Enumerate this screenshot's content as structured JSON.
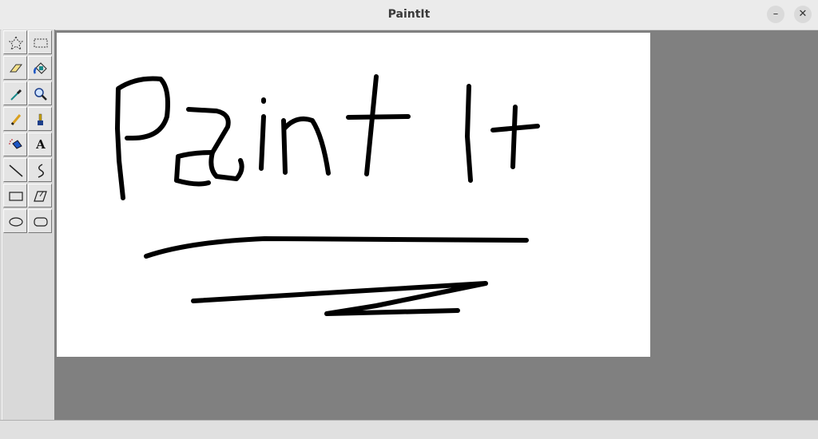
{
  "window": {
    "title": "PaintIt",
    "minimize_label": "–",
    "close_label": "✕"
  },
  "toolbox": {
    "tools": [
      {
        "name": "free-form-select-icon"
      },
      {
        "name": "rect-select-icon"
      },
      {
        "name": "eraser-icon"
      },
      {
        "name": "fill-bucket-icon"
      },
      {
        "name": "color-picker-icon"
      },
      {
        "name": "magnifier-icon"
      },
      {
        "name": "pencil-icon"
      },
      {
        "name": "brush-icon"
      },
      {
        "name": "airbrush-icon"
      },
      {
        "name": "text-tool-icon",
        "glyph": "A"
      },
      {
        "name": "line-icon"
      },
      {
        "name": "curve-icon"
      },
      {
        "name": "rectangle-icon"
      },
      {
        "name": "polygon-icon"
      },
      {
        "name": "ellipse-icon"
      },
      {
        "name": "rounded-rectangle-icon"
      }
    ]
  },
  "canvas": {
    "background": "#ffffff",
    "stroke_color": "#000000",
    "drawn_text": "Paint It"
  },
  "colors": {
    "workspace": "#808080",
    "accent_blue": "#1d56c4"
  }
}
